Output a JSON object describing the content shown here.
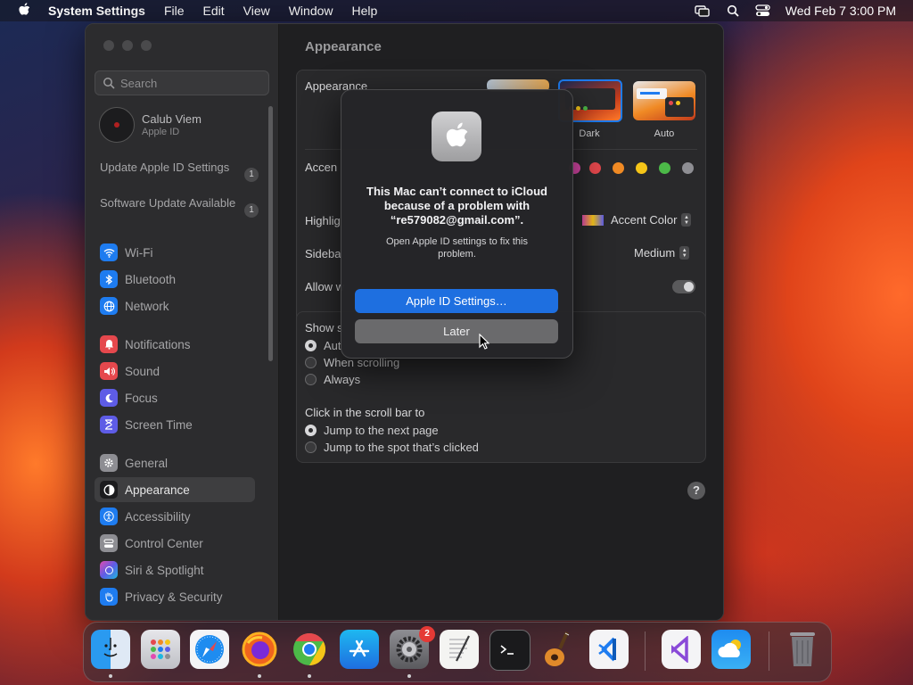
{
  "menubar": {
    "app": "System Settings",
    "items": [
      "File",
      "Edit",
      "View",
      "Window",
      "Help"
    ],
    "clock": "Wed Feb 7  3:00 PM"
  },
  "sidebar": {
    "search_placeholder": "Search",
    "profile": {
      "name": "Calub Viem",
      "sub": "Apple ID"
    },
    "notices": [
      {
        "text": "Update Apple ID Settings",
        "badge": "1"
      },
      {
        "text": "Software Update Available",
        "badge": "1"
      }
    ],
    "items": [
      {
        "label": "Wi-Fi",
        "icon": "wifi-icon",
        "color": "#1e7cf0"
      },
      {
        "label": "Bluetooth",
        "icon": "bluetooth-icon",
        "color": "#1e7cf0"
      },
      {
        "label": "Network",
        "icon": "globe-icon",
        "color": "#1e7cf0"
      },
      {
        "label": "Notifications",
        "icon": "bell-icon",
        "color": "#e5484d"
      },
      {
        "label": "Sound",
        "icon": "speaker-icon",
        "color": "#e5484d"
      },
      {
        "label": "Focus",
        "icon": "moon-icon",
        "color": "#5e5ce6"
      },
      {
        "label": "Screen Time",
        "icon": "hourglass-icon",
        "color": "#5e5ce6"
      },
      {
        "label": "General",
        "icon": "gear-icon",
        "color": "#8e8e93"
      },
      {
        "label": "Appearance",
        "icon": "appearance-icon",
        "color": "#1c1c1e"
      },
      {
        "label": "Accessibility",
        "icon": "accessibility-icon",
        "color": "#1e7cf0"
      },
      {
        "label": "Control Center",
        "icon": "control-center-icon",
        "color": "#8e8e93"
      },
      {
        "label": "Siri & Spotlight",
        "icon": "siri-icon",
        "color": "#b04fd8"
      },
      {
        "label": "Privacy & Security",
        "icon": "hand-icon",
        "color": "#1e7cf0"
      }
    ]
  },
  "main": {
    "title": "Appearance",
    "appearance_label": "Appearance",
    "modes": [
      "Dark",
      "Auto"
    ],
    "accent_label": "Accen",
    "accent_colors": [
      "#e24bb0",
      "#e5484d",
      "#f08a24",
      "#f5c518",
      "#4cb948",
      "#8e8e93"
    ],
    "highlight_label": "Highlig",
    "highlight_value": "Accent Color",
    "sidebar_label": "Sideba",
    "sidebar_value": "Medium",
    "allow_label": "Allow w",
    "show_label": "Show s",
    "show_options": [
      "Aut",
      "When scrolling",
      "Always"
    ],
    "click_label": "Click in the scroll bar to",
    "click_options": [
      "Jump to the next page",
      "Jump to the spot that’s clicked"
    ]
  },
  "dialog": {
    "title": "This Mac can’t connect to iCloud because of a problem with “re579082@gmail.com”.",
    "body": "Open Apple ID settings to fix this problem.",
    "primary": "Apple ID Settings…",
    "secondary": "Later"
  },
  "dock": {
    "settings_badge": "2"
  }
}
